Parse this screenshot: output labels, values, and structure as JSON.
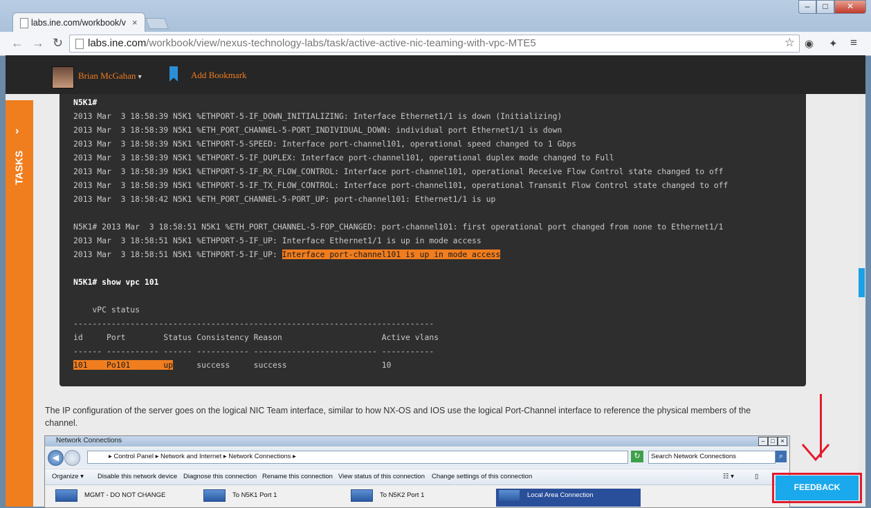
{
  "browser": {
    "tab_title": "labs.ine.com/workbook/v",
    "url_host": "labs.ine.com",
    "url_path": "/workbook/view/nexus-technology-labs/task/active-active-nic-teaming-with-vpc-MTE5"
  },
  "site_header": {
    "user_name": "Brian McGahan",
    "bookmark_label": "Add Bookmark"
  },
  "sidebar": {
    "tasks_label": "TASKS"
  },
  "terminal": {
    "lines": [
      "N5K1#",
      "2013 Mar  3 18:58:39 N5K1 %ETHPORT-5-IF_DOWN_INITIALIZING: Interface Ethernet1/1 is down (Initializing)",
      "2013 Mar  3 18:58:39 N5K1 %ETH_PORT_CHANNEL-5-PORT_INDIVIDUAL_DOWN: individual port Ethernet1/1 is down",
      "2013 Mar  3 18:58:39 N5K1 %ETHPORT-5-SPEED: Interface port-channel101, operational speed changed to 1 Gbps",
      "2013 Mar  3 18:58:39 N5K1 %ETHPORT-5-IF_DUPLEX: Interface port-channel101, operational duplex mode changed to Full",
      "2013 Mar  3 18:58:39 N5K1 %ETHPORT-5-IF_RX_FLOW_CONTROL: Interface port-channel101, operational Receive Flow Control state changed to off",
      "2013 Mar  3 18:58:39 N5K1 %ETHPORT-5-IF_TX_FLOW_CONTROL: Interface port-channel101, operational Transmit Flow Control state changed to off",
      "2013 Mar  3 18:58:42 N5K1 %ETH_PORT_CHANNEL-5-PORT_UP: port-channel101: Ethernet1/1 is up",
      "N5K1# 2013 Mar  3 18:58:51 N5K1 %ETH_PORT_CHANNEL-5-FOP_CHANGED: port-channel101: first operational port changed from none to Ethernet1/1",
      "2013 Mar  3 18:58:51 N5K1 %ETHPORT-5-IF_UP: Interface Ethernet1/1 is up in mode access",
      "2013 Mar  3 18:58:51 N5K1 %ETHPORT-5-IF_UP: ",
      "Interface port-channel101 is up in mode access",
      "N5K1# show vpc 101",
      "    vPC status",
      "----------------------------------------------------------------------------",
      "id     Port        Status Consistency Reason                     Active vlans",
      "------ ----------- ------ ----------- -------------------------- -----------",
      "101    Po101       up",
      "     success     success                    10"
    ]
  },
  "paragraph": "The IP configuration of the server goes on the logical NIC Team interface, similar to how NX-OS and IOS use the logical Port-Channel interface to reference the physical members of the channel.",
  "network_window": {
    "title": "Network Connections",
    "address": "▸ Control Panel ▸ Network and Internet ▸ Network Connections ▸",
    "search_placeholder": "Search Network Connections",
    "commands": [
      "Organize ▾",
      "Disable this network device",
      "Diagnose this connection",
      "Rename this connection",
      "View status of this connection",
      "Change settings of this connection"
    ],
    "connections": [
      "MGMT - DO NOT CHANGE",
      "To N5K1 Port 1",
      "To N5K2 Port 1",
      "Local Area Connection"
    ]
  },
  "feedback_label": "FEEDBACK"
}
